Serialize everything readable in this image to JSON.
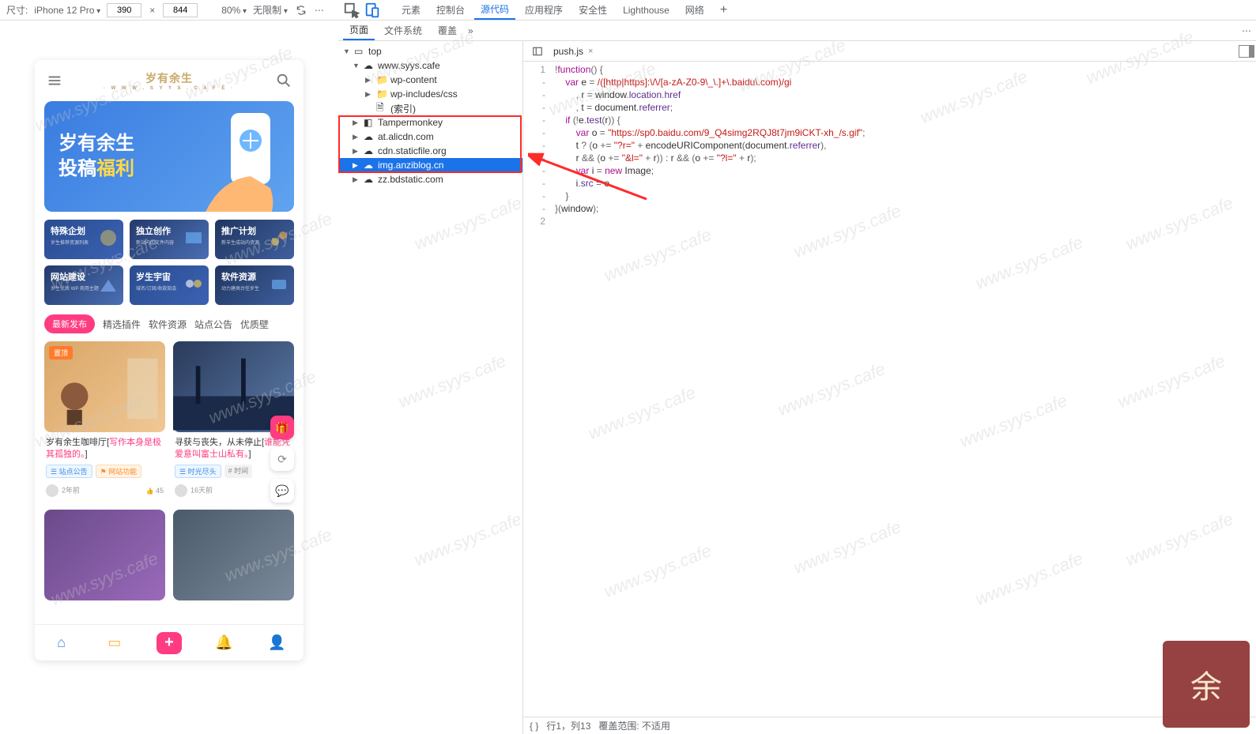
{
  "device_toolbar": {
    "label_size": "尺寸:",
    "device": "iPhone 12 Pro",
    "width": "390",
    "height": "844",
    "zoom": "80%",
    "throttle": "无限制"
  },
  "main_tabs": {
    "items": [
      "元素",
      "控制台",
      "源代码",
      "应用程序",
      "安全性",
      "Lighthouse",
      "网络"
    ],
    "active_index": 2
  },
  "sources_subtabs": {
    "items": [
      "页面",
      "文件系统",
      "覆盖"
    ],
    "active_index": 0
  },
  "file_tree": {
    "top": "top",
    "nodes": [
      {
        "icon": "cloud",
        "label": "www.syys.cafe",
        "expanded": true,
        "indent": 1
      },
      {
        "icon": "folder",
        "label": "wp-content",
        "indent": 2
      },
      {
        "icon": "folder",
        "label": "wp-includes/css",
        "indent": 2
      },
      {
        "icon": "file",
        "label": "(索引)",
        "indent": 2,
        "no_arrow": true
      },
      {
        "icon": "ext",
        "label": "Tampermonkey",
        "indent": 1
      },
      {
        "icon": "cloud",
        "label": "at.alicdn.com",
        "indent": 1,
        "boxed": true
      },
      {
        "icon": "cloud",
        "label": "cdn.staticfile.org",
        "indent": 1,
        "boxed": true
      },
      {
        "icon": "cloud",
        "label": "img.anziblog.cn",
        "indent": 1,
        "boxed": true,
        "selected": true
      },
      {
        "icon": "cloud",
        "label": "zz.bdstatic.com",
        "indent": 1,
        "boxed": true
      }
    ]
  },
  "editor": {
    "open_tab": "push.js",
    "line_labels": [
      "1",
      "-",
      "-",
      "-",
      "-",
      "-",
      "-",
      "-",
      "-",
      "-",
      "-",
      "-",
      "2"
    ]
  },
  "code_lines": [
    {
      "tokens": [
        [
          "op",
          "!"
        ],
        [
          "kw",
          "function"
        ],
        [
          "op",
          "() {"
        ]
      ]
    },
    {
      "indent": 1,
      "tokens": [
        [
          "kw",
          "var"
        ],
        [
          "sp",
          " "
        ],
        [
          "id",
          "e"
        ],
        [
          "sp",
          " "
        ],
        [
          "op",
          "="
        ],
        [
          "sp",
          " "
        ],
        [
          "re",
          "/([http|https]:\\/\\/[a-zA-Z0-9\\_\\.]+\\.baidu\\.com)/gi"
        ]
      ]
    },
    {
      "indent": 2,
      "tokens": [
        [
          "op",
          ", "
        ],
        [
          "id",
          "r"
        ],
        [
          "sp",
          " "
        ],
        [
          "op",
          "="
        ],
        [
          "sp",
          " "
        ],
        [
          "id",
          "window"
        ],
        [
          "op",
          "."
        ],
        [
          "prop",
          "location"
        ],
        [
          "op",
          "."
        ],
        [
          "prop",
          "href"
        ]
      ]
    },
    {
      "indent": 2,
      "tokens": [
        [
          "op",
          ", "
        ],
        [
          "id",
          "t"
        ],
        [
          "sp",
          " "
        ],
        [
          "op",
          "="
        ],
        [
          "sp",
          " "
        ],
        [
          "id",
          "document"
        ],
        [
          "op",
          "."
        ],
        [
          "prop",
          "referrer"
        ],
        [
          "op",
          ";"
        ]
      ]
    },
    {
      "indent": 1,
      "tokens": [
        [
          "kw",
          "if"
        ],
        [
          "sp",
          " "
        ],
        [
          "op",
          "(!"
        ],
        [
          "id",
          "e"
        ],
        [
          "op",
          "."
        ],
        [
          "prop",
          "test"
        ],
        [
          "op",
          "("
        ],
        [
          "id",
          "r"
        ],
        [
          "op",
          ")) {"
        ]
      ]
    },
    {
      "indent": 2,
      "tokens": [
        [
          "kw",
          "var"
        ],
        [
          "sp",
          " "
        ],
        [
          "id",
          "o"
        ],
        [
          "sp",
          " "
        ],
        [
          "op",
          "="
        ],
        [
          "sp",
          " "
        ],
        [
          "str",
          "\"https://sp0.baidu.com/9_Q4simg2RQJ8t7jm9iCKT-xh_/s.gif\""
        ],
        [
          "op",
          ";"
        ]
      ]
    },
    {
      "indent": 2,
      "tokens": [
        [
          "id",
          "t"
        ],
        [
          "sp",
          " "
        ],
        [
          "op",
          "? ("
        ],
        [
          "id",
          "o"
        ],
        [
          "sp",
          " "
        ],
        [
          "op",
          "+="
        ],
        [
          "sp",
          " "
        ],
        [
          "str",
          "\"?r=\""
        ],
        [
          "sp",
          " "
        ],
        [
          "op",
          "+"
        ],
        [
          "sp",
          " "
        ],
        [
          "id",
          "encodeURIComponent"
        ],
        [
          "op",
          "("
        ],
        [
          "id",
          "document"
        ],
        [
          "op",
          "."
        ],
        [
          "prop",
          "referrer"
        ],
        [
          "op",
          "),"
        ]
      ]
    },
    {
      "indent": 2,
      "tokens": [
        [
          "id",
          "r"
        ],
        [
          "sp",
          " "
        ],
        [
          "op",
          "&& ("
        ],
        [
          "id",
          "o"
        ],
        [
          "sp",
          " "
        ],
        [
          "op",
          "+="
        ],
        [
          "sp",
          " "
        ],
        [
          "str",
          "\"&l=\""
        ],
        [
          "sp",
          " "
        ],
        [
          "op",
          "+"
        ],
        [
          "sp",
          " "
        ],
        [
          "id",
          "r"
        ],
        [
          "op",
          ")) : "
        ],
        [
          "id",
          "r"
        ],
        [
          "sp",
          " "
        ],
        [
          "op",
          "&& ("
        ],
        [
          "id",
          "o"
        ],
        [
          "sp",
          " "
        ],
        [
          "op",
          "+="
        ],
        [
          "sp",
          " "
        ],
        [
          "str",
          "\"?l=\""
        ],
        [
          "sp",
          " "
        ],
        [
          "op",
          "+"
        ],
        [
          "sp",
          " "
        ],
        [
          "id",
          "r"
        ],
        [
          "op",
          ");"
        ]
      ]
    },
    {
      "indent": 2,
      "tokens": [
        [
          "kw",
          "var"
        ],
        [
          "sp",
          " "
        ],
        [
          "id",
          "i"
        ],
        [
          "sp",
          " "
        ],
        [
          "op",
          "="
        ],
        [
          "sp",
          " "
        ],
        [
          "kw",
          "new"
        ],
        [
          "sp",
          " "
        ],
        [
          "id",
          "Image"
        ],
        [
          "op",
          ";"
        ]
      ]
    },
    {
      "indent": 2,
      "tokens": [
        [
          "id",
          "i"
        ],
        [
          "op",
          "."
        ],
        [
          "prop",
          "src"
        ],
        [
          "sp",
          " "
        ],
        [
          "op",
          "="
        ],
        [
          "sp",
          " "
        ],
        [
          "id",
          "o"
        ]
      ]
    },
    {
      "indent": 1,
      "tokens": [
        [
          "op",
          "}"
        ]
      ]
    },
    {
      "tokens": [
        [
          "op",
          "}("
        ],
        [
          "id",
          "window"
        ],
        [
          "op",
          ");"
        ]
      ]
    }
  ],
  "status_bar": {
    "pos": "行1，列13",
    "coverage": "覆盖范围: 不适用"
  },
  "mobile": {
    "logo_top": "岁有余生",
    "logo_sub": "· W W W . S Y Y S . C A F E ·",
    "banner_line1": "岁有余生",
    "banner_line2_a": "投稿",
    "banner_line2_b": "福利",
    "tiles": [
      {
        "t": "特殊企划",
        "s": "岁生推荐资源列表"
      },
      {
        "t": "独立创作",
        "s": "新站内的文件内容"
      },
      {
        "t": "推广计划",
        "s": "新羊生成站内资源"
      },
      {
        "t": "网站建设",
        "s": "岁生优质 WP 商用主题"
      },
      {
        "t": "岁生宇宙",
        "s": "域名/订阅/收款知会"
      },
      {
        "t": "软件资源",
        "s": "动力建高台任岁生"
      }
    ],
    "filters": [
      "最新发布",
      "精选插件",
      "软件资源",
      "站点公告",
      "优质壁"
    ],
    "cards": [
      {
        "badge": "置顶",
        "title_a": "岁有余生咖啡厅[",
        "title_hl": "写作本身是极其孤独的。",
        "title_b": "]",
        "tags": [
          {
            "cls": "blue",
            "t": "☰ 站点公告"
          },
          {
            "cls": "orange",
            "t": "⚑ 网站功能"
          }
        ],
        "meta_time": "2年前",
        "meta_likes": "45"
      },
      {
        "title_a": "寻获与丧失，从未停止[",
        "title_hl": "谁能凭爱意叫富士山私有。",
        "title_b": "]",
        "tags": [
          {
            "cls": "blue",
            "t": "☰ 时光尽头"
          },
          {
            "cls": "gray",
            "t": "# 时间"
          }
        ],
        "meta_time": "16天前",
        "meta_likes": ""
      }
    ],
    "bnav_icons": [
      "home",
      "msg",
      "plus",
      "bell",
      "user"
    ]
  },
  "watermark_text": "www.syys.cafe"
}
